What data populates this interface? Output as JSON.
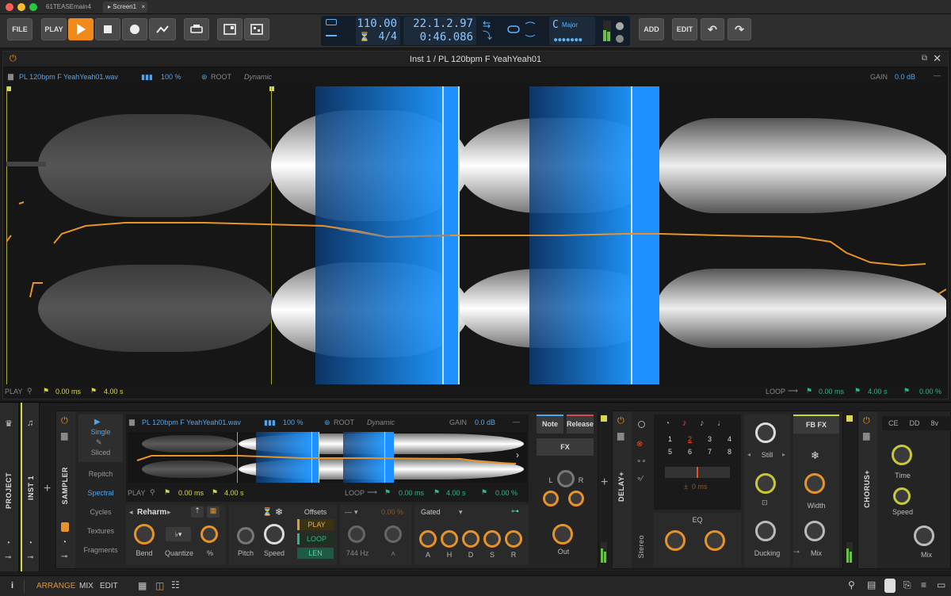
{
  "window": {
    "tabs": [
      {
        "label": "61TEASEmain4 *"
      },
      {
        "label": "Screen1"
      }
    ],
    "close_glyph": "×"
  },
  "toolbar": {
    "file_label": "FILE",
    "play_label": "PLAY",
    "add_label": "ADD",
    "edit_label": "EDIT",
    "tempo": "110.00",
    "signature": "4/4",
    "position": "22.1.2.97",
    "time": "0:46.086",
    "key_root": "C",
    "key_scale": "Major"
  },
  "editor": {
    "title": "Inst 1 / PL 120bpm F YeahYeah01",
    "file_name": "PL 120bpm F YeahYeah01.wav",
    "speed": "100 %",
    "root_label": "ROOT",
    "mode": "Dynamic",
    "gain_label": "GAIN",
    "gain_value": "0.0 dB",
    "footer": {
      "play_label": "PLAY",
      "play_start": "0.00 ms",
      "play_end": "4.00 s",
      "loop_label": "LOOP",
      "loop_start": "0.00 ms",
      "loop_end": "4.00 s",
      "loop_fade": "0.00 %"
    }
  },
  "chain": {
    "tabs": {
      "project": "PROJECT",
      "inst": "INST 1",
      "sampler": "SAMPLER",
      "delay": "DELAY+",
      "chorus": "CHORUS+"
    },
    "sampler": {
      "modes": [
        "Single",
        "Sliced"
      ],
      "algos": [
        "Repitch",
        "Spectral",
        "Cycles",
        "Textures",
        "Fragments"
      ],
      "active_algo": "Spectral",
      "file_name": "PL 120bpm F YeahYeah01.wav",
      "speed": "100 %",
      "root_label": "ROOT",
      "mode": "Dynamic",
      "gain_label": "GAIN",
      "gain_value": "0.0 dB",
      "play_label": "PLAY",
      "play_start": "0.00 ms",
      "play_end": "4.00 s",
      "loop_label": "LOOP",
      "loop_start": "0.00 ms",
      "loop_end": "4.00 s",
      "loop_fade": "0.00 %",
      "reharm": "Reharm",
      "knobs": {
        "bend": "Bend",
        "quantize": "Quantize",
        "percent": "%",
        "pitch": "Pitch",
        "speed": "Speed"
      },
      "offsets": {
        "title": "Offsets",
        "play": "PLAY",
        "loop": "LOOP",
        "len": "LEN"
      },
      "filter": {
        "freq": "744 Hz",
        "amount": "0.00 %",
        "dash": "—"
      },
      "env": {
        "type": "Gated",
        "labels": [
          "A",
          "H",
          "D",
          "S",
          "R"
        ]
      },
      "buttons": {
        "note": "Note",
        "release": "Release",
        "fx": "FX",
        "out": "Out",
        "l": "L",
        "r": "R"
      }
    },
    "delay": {
      "stereo": "Stereo",
      "grid": [
        [
          "1",
          "2",
          "3",
          "4"
        ],
        [
          "5",
          "6",
          "7",
          "8"
        ]
      ],
      "time": "0 ms",
      "eq": "EQ",
      "still": "Still",
      "ducking": "Ducking",
      "fbfx": "FB FX",
      "width": "Width",
      "mix": "Mix"
    },
    "chorus": {
      "tabs": [
        "CE",
        "DD",
        "8v"
      ],
      "time": "Time",
      "speed": "Speed",
      "mix": "Mix"
    }
  },
  "status": {
    "arrange": "ARRANGE",
    "mix": "MIX",
    "edit": "EDIT",
    "info": "i"
  },
  "colors": {
    "accent": "#e8922a",
    "blue": "#1e90ff",
    "yellow": "#d8d84a"
  }
}
